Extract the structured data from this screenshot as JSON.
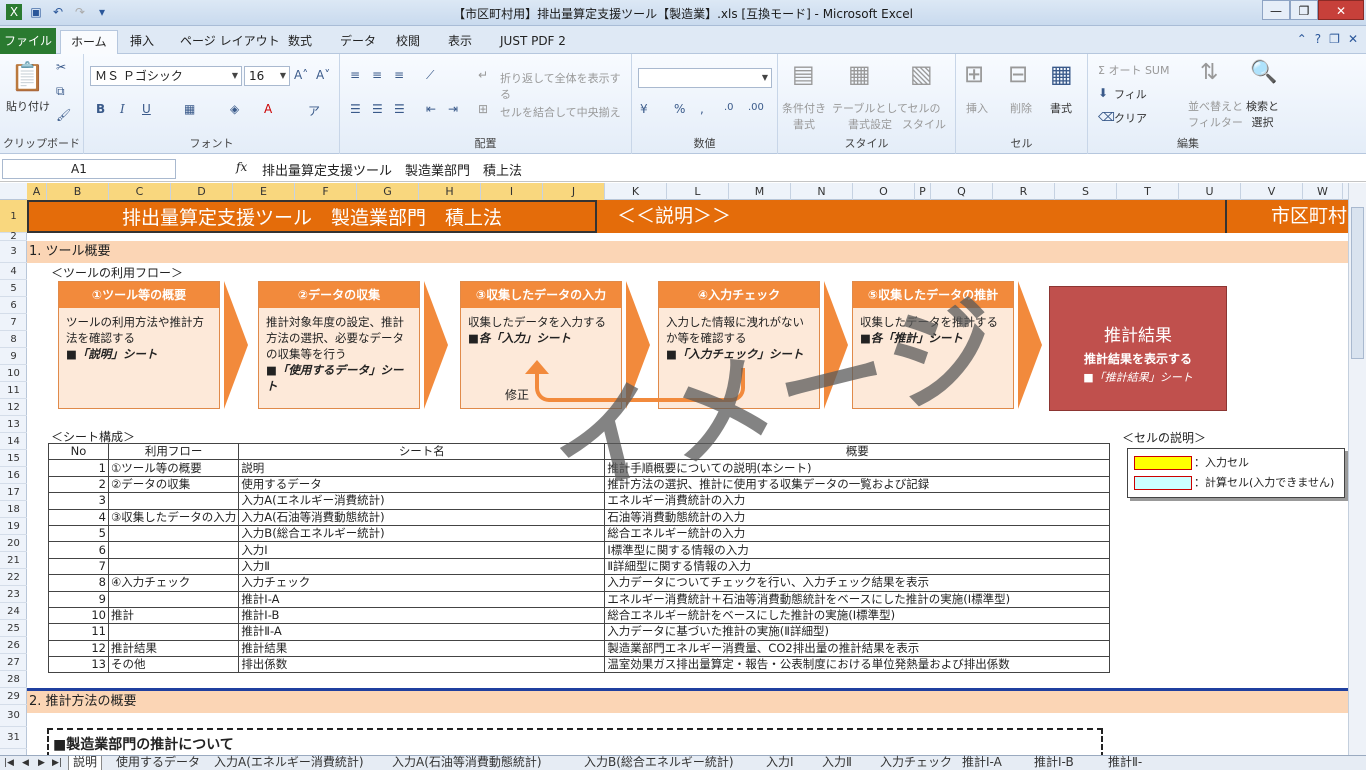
{
  "window": {
    "title": "【市区町村用】排出量算定支援ツール【製造業】.xls  [互換モード] - Microsoft Excel",
    "btn_min": "—",
    "btn_max": "❐",
    "btn_close": "✕"
  },
  "ribbon_tabs": [
    "ファイル",
    "ホーム",
    "挿入",
    "ページ レイアウト",
    "数式",
    "データ",
    "校閲",
    "表示",
    "JUST PDF 2"
  ],
  "ribbon": {
    "clipboard": {
      "paste": "貼り付け",
      "label": "クリップボード"
    },
    "font": {
      "name": "ＭＳ Ｐゴシック",
      "size": "16",
      "bold": "B",
      "italic": "I",
      "underline": "U",
      "label": "フォント"
    },
    "alignment": {
      "wrap": "折り返して全体を表示する",
      "merge": "セルを結合して中央揃え",
      "label": "配置"
    },
    "number": {
      "format": "",
      "label": "数値"
    },
    "styles": {
      "conditional": "条件付き\n書式",
      "table": "テーブルとして\n書式設定",
      "cell_style": "セルの\nスタイル",
      "label": "スタイル"
    },
    "cells": {
      "insert": "挿入",
      "delete": "削除",
      "format": "書式",
      "label": "セル"
    },
    "editing": {
      "autosum": "Σ オート SUM",
      "fill": "フィル",
      "clear": "クリア",
      "sort": "並べ替えと\nフィルター",
      "find": "検索と\n選択",
      "label": "編集"
    }
  },
  "formula_bar": {
    "name_box": "A1",
    "fx": "fx",
    "content": "排出量算定支援ツール　製造業部門　積上法"
  },
  "columns": [
    "A",
    "B",
    "C",
    "D",
    "E",
    "F",
    "G",
    "H",
    "I",
    "J",
    "K",
    "L",
    "M",
    "N",
    "O",
    "P",
    "Q",
    "R",
    "S",
    "T",
    "U",
    "V",
    "W"
  ],
  "rows": [
    "1",
    "2",
    "3",
    "4",
    "5",
    "6",
    "7",
    "8",
    "9",
    "10",
    "11",
    "12",
    "13",
    "14",
    "15",
    "16",
    "17",
    "18",
    "19",
    "20",
    "21",
    "22",
    "23",
    "24",
    "25",
    "26",
    "27",
    "28",
    "29",
    "30",
    "31",
    "32"
  ],
  "sheet": {
    "title": "排出量算定支援ツール　製造業部門　積上法",
    "explain": "＜＜説明＞＞",
    "right_title": "市区町村",
    "section1": "1. ツール概要",
    "flow_label": "＜ツールの利用フロー＞",
    "steps": [
      {
        "head": "①ツール等の概要",
        "body": "ツールの利用方法や推計方法を確認する",
        "ref": "■「説明」シート"
      },
      {
        "head": "②データの収集",
        "body": "推計対象年度の設定、推計方法の選択、必要なデータの収集等を行う",
        "ref": "■「使用するデータ」シート"
      },
      {
        "head": "③収集したデータの入力",
        "body": "収集したデータを入力する",
        "ref": "■各「入力」シート"
      },
      {
        "head": "④入力チェック",
        "body": "入力した情報に洩れがないか等を確認する",
        "ref": "■「入力チェック」シート"
      },
      {
        "head": "⑤収集したデータの推計",
        "body": "収集したデータを推計する",
        "ref": "■各「推計」シート"
      }
    ],
    "result": {
      "title": "推計結果",
      "desc": "推計結果を表示する",
      "ref": "■「推計結果」シート"
    },
    "fix_label": "修正",
    "watermark": "イメージ",
    "struct_label": "＜シート構成＞",
    "table_headers": [
      "No",
      "利用フロー",
      "シート名",
      "概要"
    ],
    "table_rows": [
      {
        "no": "1",
        "flow": "①ツール等の概要",
        "sheet": "説明",
        "desc": "推計手順概要についての説明(本シート)"
      },
      {
        "no": "2",
        "flow": "②データの収集",
        "sheet": "使用するデータ",
        "desc": "推計方法の選択、推計に使用する収集データの一覧および記録"
      },
      {
        "no": "3",
        "flow": "",
        "sheet": "入力A(エネルギー消費統計)",
        "desc": "エネルギー消費統計の入力"
      },
      {
        "no": "4",
        "flow": "③収集したデータの入力",
        "sheet": "入力A(石油等消費動態統計)",
        "desc": "石油等消費動態統計の入力"
      },
      {
        "no": "5",
        "flow": "",
        "sheet": "入力B(総合エネルギー統計)",
        "desc": "総合エネルギー統計の入力"
      },
      {
        "no": "6",
        "flow": "",
        "sheet": "入力Ⅰ",
        "desc": "Ⅰ標準型に関する情報の入力"
      },
      {
        "no": "7",
        "flow": "",
        "sheet": "入力Ⅱ",
        "desc": "Ⅱ詳細型に関する情報の入力"
      },
      {
        "no": "8",
        "flow": "④入力チェック",
        "sheet": "入力チェック",
        "desc": "入力データについてチェックを行い、入力チェック結果を表示"
      },
      {
        "no": "9",
        "flow": "",
        "sheet": "推計Ⅰ-A",
        "desc": "エネルギー消費統計＋石油等消費動態統計をベースにした推計の実施(Ⅰ標準型)"
      },
      {
        "no": "10",
        "flow": "推計",
        "sheet": "推計Ⅰ-B",
        "desc": "総合エネルギー統計をベースにした推計の実施(Ⅰ標準型)"
      },
      {
        "no": "11",
        "flow": "",
        "sheet": "推計Ⅱ-A",
        "desc": "入力データに基づいた推計の実施(Ⅱ詳細型)"
      },
      {
        "no": "12",
        "flow": "推計結果",
        "sheet": "推計結果",
        "desc": "製造業部門エネルギー消費量、CO2排出量の推計結果を表示"
      },
      {
        "no": "13",
        "flow": "その他",
        "sheet": "排出係数",
        "desc": "温室効果ガス排出量算定・報告・公表制度における単位発熱量および排出係数"
      }
    ],
    "legend_label": "＜セルの説明＞",
    "legend": [
      {
        "label": "：入力セル",
        "color": "#ffff00"
      },
      {
        "label": "：計算セル(入力できません)",
        "color": "#ccffff"
      }
    ],
    "section2": "2. 推計方法の概要",
    "method_title": "■製造業部門の推計について"
  },
  "sheet_tabs": [
    "説明",
    "使用するデータ",
    "入力A(エネルギー消費統計)",
    "入力A(石油等消費動態統計)",
    "入力B(総合エネルギー統計)",
    "入力Ⅰ",
    "入力Ⅱ",
    "入力チェック",
    "推計Ⅰ-A",
    "推計Ⅰ-B",
    "推計Ⅱ-"
  ],
  "colors": {
    "accent": "#e46c0a",
    "step": "#f28a3c",
    "result": "#c0504d",
    "section": "#fbd5b5"
  }
}
